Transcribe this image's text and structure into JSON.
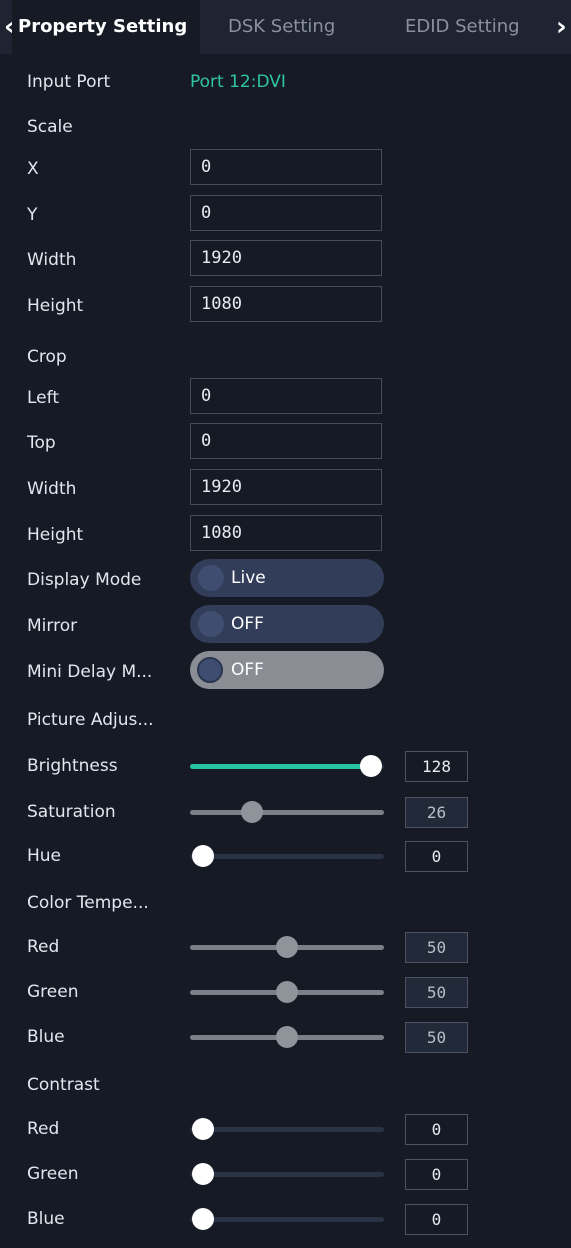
{
  "tabs": [
    {
      "label": "Property Setting"
    },
    {
      "label": "DSK Setting"
    },
    {
      "label": "EDID Setting"
    }
  ],
  "input_port": {
    "label": "Input Port",
    "value": "Port 12:DVI"
  },
  "scale": {
    "section": "Scale",
    "fields": [
      {
        "label": "X",
        "value": "0"
      },
      {
        "label": "Y",
        "value": "0"
      },
      {
        "label": "Width",
        "value": "1920"
      },
      {
        "label": "Height",
        "value": "1080"
      }
    ]
  },
  "crop": {
    "section": "Crop",
    "fields": [
      {
        "label": "Left",
        "value": "0"
      },
      {
        "label": "Top",
        "value": "0"
      },
      {
        "label": "Width",
        "value": "1920"
      },
      {
        "label": "Height",
        "value": "1080"
      }
    ]
  },
  "display_mode": {
    "label": "Display Mode",
    "value": "Live"
  },
  "mirror": {
    "label": "Mirror",
    "value": "OFF"
  },
  "mini_delay": {
    "label": "Mini Delay M...",
    "value": "OFF"
  },
  "picture_adjust": {
    "section": "Picture Adjus...",
    "sliders": [
      {
        "label": "Brightness",
        "value": "128",
        "fraction": 1.0
      },
      {
        "label": "Saturation",
        "value": "26",
        "fraction": 0.29
      },
      {
        "label": "Hue",
        "value": "0",
        "fraction": 0.0
      }
    ]
  },
  "color_temperature": {
    "section": "Color Tempe...",
    "sliders": [
      {
        "label": "Red",
        "value": "50",
        "fraction": 0.5
      },
      {
        "label": "Green",
        "value": "50",
        "fraction": 0.5
      },
      {
        "label": "Blue",
        "value": "50",
        "fraction": 0.5
      }
    ]
  },
  "contrast": {
    "section": "Contrast",
    "sliders": [
      {
        "label": "Red",
        "value": "0",
        "fraction": 0.0
      },
      {
        "label": "Green",
        "value": "0",
        "fraction": 0.0
      },
      {
        "label": "Blue",
        "value": "0",
        "fraction": 0.0
      }
    ]
  },
  "colors": {
    "accent": "#27c3a0",
    "background": "#161a25",
    "port_text": "#2fc6a2"
  },
  "icons": {
    "prev": "chevron-left-icon",
    "next": "chevron-right-icon"
  }
}
